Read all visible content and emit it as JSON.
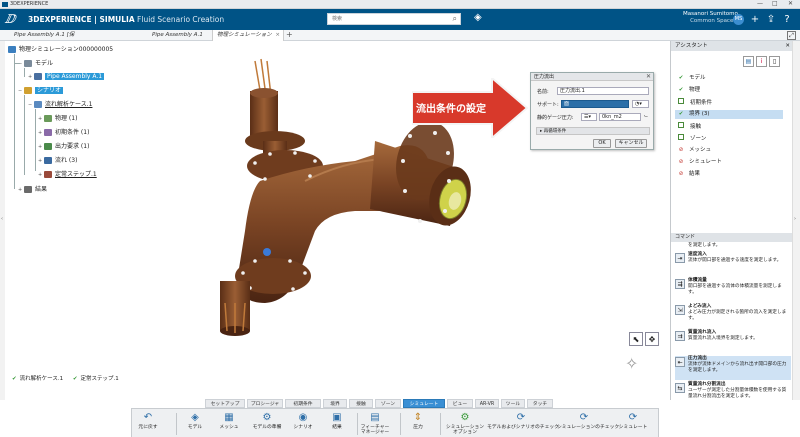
{
  "app": {
    "window_title": "3DEXPERIENCE",
    "brand_bold": "3DEXPERIENCE | SIMULIA",
    "brand_light": "Fluid Scenario Creation"
  },
  "search": {
    "placeholder": "検索"
  },
  "user": {
    "name": "Masanori Sumitomo",
    "space": "Common Space ▾",
    "avatar": "MS"
  },
  "tabs": [
    {
      "label": "Pipe Assembly A.1 [保護]"
    },
    {
      "label": "Pipe Assembly A.1 (探索)"
    },
    {
      "label": "物理シミュレーション00000"
    }
  ],
  "tree": {
    "root": "物理シミュレーション000000005",
    "model": "モデル",
    "pipe": "Pipe Assembly A.1",
    "scenario": "シナリオ",
    "flowcase": "流れ解析ケース.1",
    "physics": "物理 (1)",
    "initial": "初期条件 (1)",
    "output": "出力要求 (1)",
    "flow": "流れ (3)",
    "steady": "定常ステップ.1",
    "results": "結果"
  },
  "status": {
    "item1": "流れ解析ケース.1",
    "item2": "定常ステップ.1"
  },
  "callout": {
    "text": "流出条件の設定"
  },
  "dialog": {
    "title": "圧力流出",
    "name_label": "名前:",
    "name_value": "圧力流出.1",
    "support_label": "サポート:",
    "support_value": "面",
    "pressure_label": "静的ゲージ圧力:",
    "pressure_value": "0kn_m2",
    "section": "▸ 再循環条件",
    "ok": "OK",
    "cancel": "キャンセル"
  },
  "assistant": {
    "title": "アシスタント",
    "steps": [
      {
        "label": "モデル",
        "state": "ok"
      },
      {
        "label": "物理",
        "state": "ok"
      },
      {
        "label": "初期条件",
        "state": "box"
      },
      {
        "label": "境界 (3)",
        "state": "ok"
      },
      {
        "label": "接触",
        "state": "box"
      },
      {
        "label": "ゾーン",
        "state": "box"
      },
      {
        "label": "メッシュ",
        "state": "no"
      },
      {
        "label": "シミュレート",
        "state": "no"
      },
      {
        "label": "結果",
        "state": "no"
      }
    ],
    "commands_title": "コマンド",
    "cmd_intro": "を測定します。",
    "commands": [
      {
        "title": "速度流入",
        "desc": "流体が開口部を通過する速度を測定します。"
      },
      {
        "title": "体積流量",
        "desc": "開口部を通過する流体の体積流量を測定します。"
      },
      {
        "title": "よどみ流入",
        "desc": "よどみ圧力が測定される箇所の流入を測定します。"
      },
      {
        "title": "質量流れ流入",
        "desc": "質量流れ流入境界を測定します。"
      },
      {
        "title": "圧力流出",
        "desc": "流体が流体ドメインから流れ出す開口部の圧力を測定します。"
      },
      {
        "title": "質量流れ分割流出",
        "desc": "ユーザーが測定した分割量体積数を使用する質量流れ分割流出を測定します。"
      }
    ]
  },
  "bottom_tabs": [
    "セットアップ",
    "プロシージャ",
    "初期条件",
    "境界",
    "接触",
    "ゾーン",
    "シミュレート",
    "ビュー",
    "AR-VR",
    "ツール",
    "タッチ"
  ],
  "toolbar": {
    "undo": "元に戻す",
    "model": "モデル",
    "mesh": "メッシュ",
    "prep": "モデルの準備",
    "scenario": "シナリオ",
    "results": "結果",
    "feature": "フィーチャーマネージャー",
    "pressure": "圧力",
    "sim_option": "シミュレーションオプション",
    "check1": "モデルおよびシナリオのチェック",
    "check2": "シミュレーションのチェック",
    "simulate": "シミュレート"
  }
}
